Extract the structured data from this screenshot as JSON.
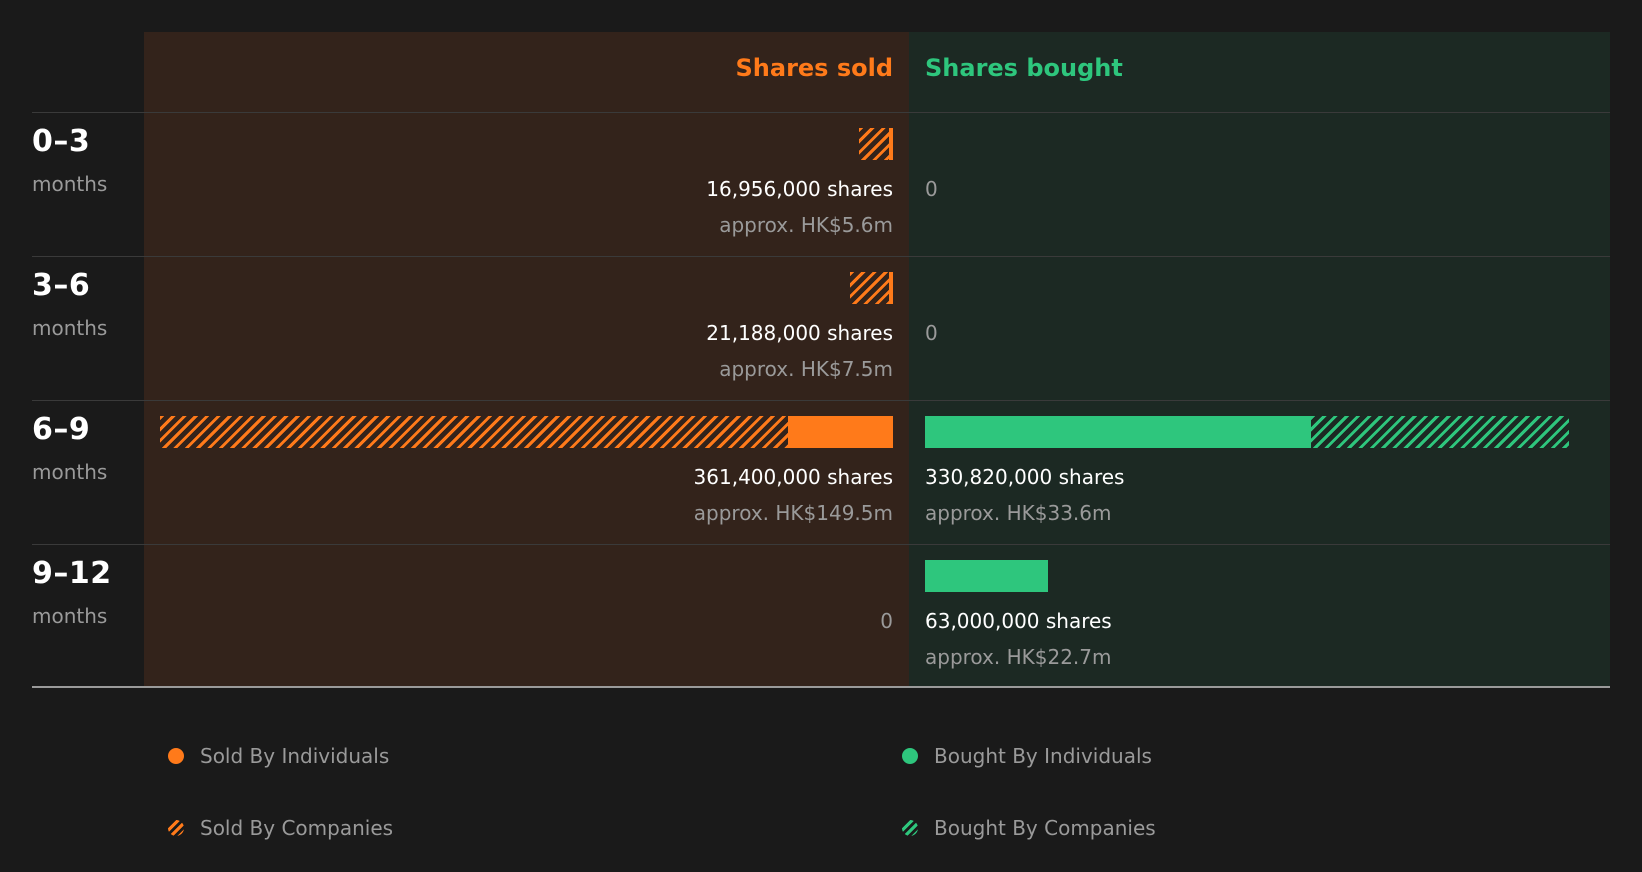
{
  "colors": {
    "sold": "#ff7a1a",
    "bought": "#2ec67d",
    "sold_bg": "#33231b",
    "bought_bg": "#1c2923"
  },
  "header": {
    "sold": "Shares sold",
    "bought": "Shares bought"
  },
  "rows": [
    {
      "label": "0–3",
      "sub": "months",
      "sold": {
        "shares_text": "16,956,000 shares",
        "approx_text": "approx. HK$5.6m",
        "zero_text": null
      },
      "bought": {
        "shares_text": null,
        "approx_text": null,
        "zero_text": "0"
      }
    },
    {
      "label": "3–6",
      "sub": "months",
      "sold": {
        "shares_text": "21,188,000 shares",
        "approx_text": "approx. HK$7.5m",
        "zero_text": null
      },
      "bought": {
        "shares_text": null,
        "approx_text": null,
        "zero_text": "0"
      }
    },
    {
      "label": "6–9",
      "sub": "months",
      "sold": {
        "shares_text": "361,400,000 shares",
        "approx_text": "approx. HK$149.5m",
        "zero_text": null
      },
      "bought": {
        "shares_text": "330,820,000 shares",
        "approx_text": "approx. HK$33.6m",
        "zero_text": null
      }
    },
    {
      "label": "9–12",
      "sub": "months",
      "sold": {
        "shares_text": null,
        "approx_text": null,
        "zero_text": "0"
      },
      "bought": {
        "shares_text": "63,000,000 shares",
        "approx_text": "approx. HK$22.7m",
        "zero_text": null
      }
    }
  ],
  "legend": {
    "sold_individuals": "Sold By Individuals",
    "sold_companies": "Sold By Companies",
    "bought_individuals": "Bought By Individuals",
    "bought_companies": "Bought By Companies"
  },
  "chart_data": {
    "type": "bar",
    "categories": [
      "0–3 months",
      "3–6 months",
      "6–9 months",
      "9–12 months"
    ],
    "series": [
      {
        "name": "Sold By Individuals",
        "values": [
          2200000,
          1900000,
          52000000,
          0
        ]
      },
      {
        "name": "Sold By Companies",
        "values": [
          14756000,
          19288000,
          309400000,
          0
        ]
      },
      {
        "name": "Bought By Individuals",
        "values": [
          0,
          0,
          198000000,
          63000000
        ]
      },
      {
        "name": "Bought By Companies",
        "values": [
          0,
          0,
          132820000,
          0
        ]
      }
    ],
    "totals_sold": [
      16956000,
      21188000,
      361400000,
      0
    ],
    "totals_bought": [
      0,
      0,
      330820000,
      63000000
    ],
    "max_value": 361400000
  }
}
